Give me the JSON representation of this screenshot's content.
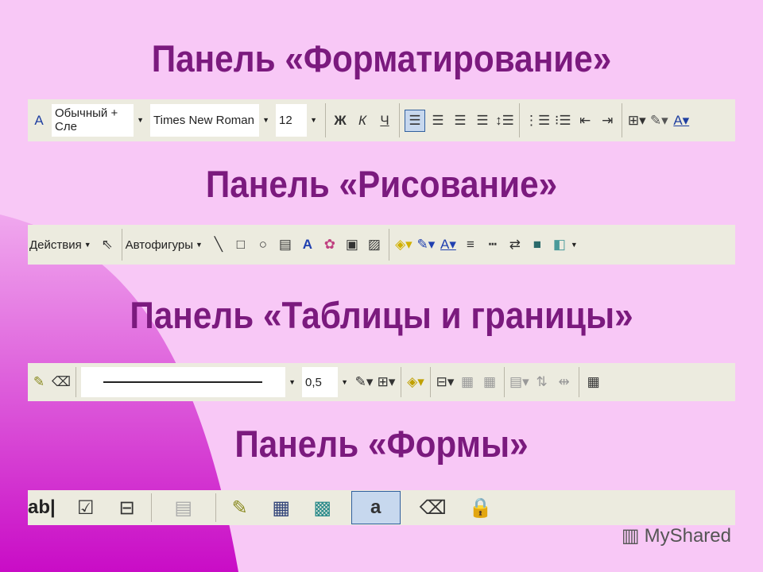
{
  "titles": {
    "formatting": "Панель «Форматирование»",
    "drawing": "Панель «Рисование»",
    "tables": "Панель «Таблицы и границы»",
    "forms": "Панель «Формы»"
  },
  "formatting": {
    "style": "Обычный + Сле",
    "font": "Times New Roman",
    "size": "12",
    "bold": "Ж",
    "italic": "К",
    "underline": "Ч"
  },
  "drawing": {
    "actions": "Действия",
    "autoshapes": "Автофигуры"
  },
  "tables": {
    "line_weight": "0,5"
  },
  "forms": {
    "text_field": "ab|"
  },
  "watermark": "MyShared",
  "colors": {
    "background": "#f8c8f6",
    "accent": "#cc10c8",
    "title": "#7b1a7e",
    "toolbar": "#ecebdf"
  }
}
